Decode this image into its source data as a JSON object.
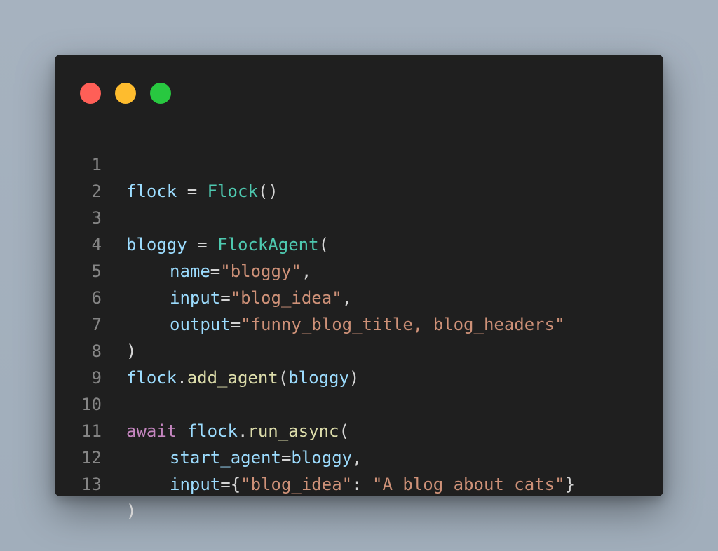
{
  "window": {
    "controls": [
      {
        "name": "close",
        "color": "#ff5f57"
      },
      {
        "name": "minimize",
        "color": "#febc2e"
      },
      {
        "name": "maximize",
        "color": "#28c840"
      }
    ]
  },
  "code": {
    "language": "python",
    "line_numbers": [
      "1",
      "2",
      "3",
      "4",
      "5",
      "6",
      "7",
      "8",
      "9",
      "10",
      "11",
      "12",
      "13"
    ],
    "lines": {
      "l1": {
        "var": "flock",
        "op": " = ",
        "cls": "Flock",
        "rest": "()"
      },
      "l3": {
        "var": "bloggy",
        "op": " = ",
        "cls": "FlockAgent",
        "rest": "("
      },
      "l4": {
        "param": "name",
        "eq": "=",
        "str": "\"bloggy\"",
        "rest": ","
      },
      "l5": {
        "param": "input",
        "eq": "=",
        "str": "\"blog_idea\"",
        "rest": ","
      },
      "l6": {
        "param": "output",
        "eq": "=",
        "str": "\"funny_blog_title, blog_headers\""
      },
      "l7": {
        "text": ")"
      },
      "l8": {
        "obj": "flock",
        "dot": ".",
        "fn": "add_agent",
        "open": "(",
        "arg": "bloggy",
        "close": ")"
      },
      "l10": {
        "kw": "await",
        "sp": " ",
        "obj": "flock",
        "dot": ".",
        "fn": "run_async",
        "open": "("
      },
      "l11": {
        "param": "start_agent",
        "eq": "=",
        "arg": "bloggy",
        "rest": ","
      },
      "l12": {
        "param": "input",
        "eq": "=",
        "open": "{",
        "key": "\"blog_idea\"",
        "colon": ": ",
        "val": "\"A blog about cats\"",
        "close": "}"
      },
      "l13": {
        "text": ")"
      }
    },
    "colors": {
      "variable": "#9cdcfe",
      "class": "#4ec9b0",
      "string": "#ce9178",
      "function": "#dcdcaa",
      "keyword": "#c586c0",
      "punctuation": "#d4d4d4",
      "line_number": "#858585",
      "background": "#1f1f1f"
    }
  }
}
